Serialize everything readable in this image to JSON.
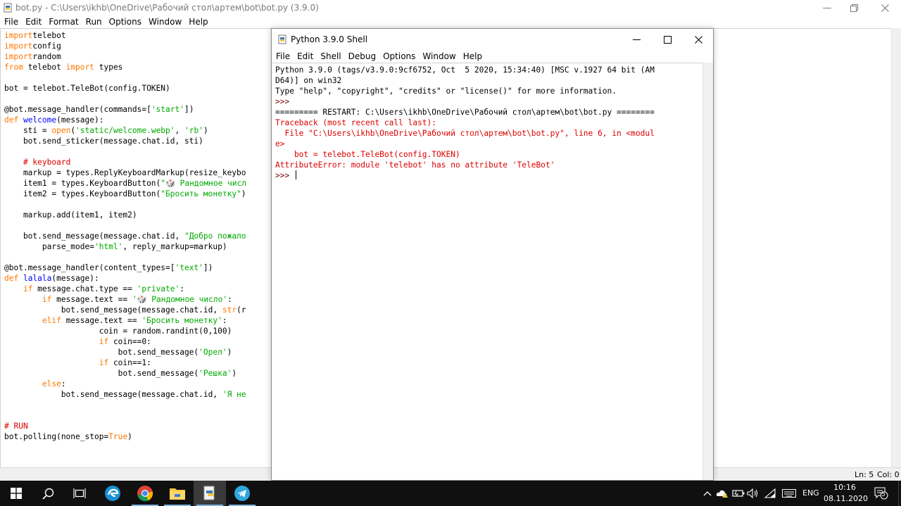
{
  "editor": {
    "title": "bot.py - C:\\Users\\ikhb\\OneDrive\\Рабочий стол\\артем\\bot\\bot.py (3.9.0)",
    "menu": [
      "File",
      "Edit",
      "Format",
      "Run",
      "Options",
      "Window",
      "Help"
    ],
    "code_lines": [
      [
        [
          "kw",
          "import"
        ],
        [
          "",
          "telebot"
        ]
      ],
      [
        [
          "kw",
          "import"
        ],
        [
          "",
          "config"
        ]
      ],
      [
        [
          "kw",
          "import"
        ],
        [
          "",
          "random"
        ]
      ],
      [
        [
          "kw",
          "from"
        ],
        [
          "",
          " telebot "
        ],
        [
          "kw",
          "import"
        ],
        [
          "",
          " types"
        ]
      ],
      [],
      [
        [
          "",
          "bot = telebot.TeleBot(config.TOKEN)"
        ]
      ],
      [],
      [
        [
          "",
          "@bot.message_handler(commands=["
        ],
        [
          "str",
          "'start'"
        ],
        [
          "",
          "])"
        ]
      ],
      [
        [
          "kw",
          "def"
        ],
        [
          "",
          " "
        ],
        [
          "def",
          "welcome"
        ],
        [
          "",
          "(message):"
        ]
      ],
      [
        [
          "",
          "    sti = "
        ],
        [
          "kw",
          "open"
        ],
        [
          "",
          "("
        ],
        [
          "str",
          "'static/welcome.webp'"
        ],
        [
          "",
          ", "
        ],
        [
          "str",
          "'rb'"
        ],
        [
          "",
          ")"
        ]
      ],
      [
        [
          "",
          "    bot.send_sticker(message.chat.id, sti)"
        ]
      ],
      [],
      [
        [
          "",
          "    "
        ],
        [
          "cm",
          "# keyboard"
        ]
      ],
      [
        [
          "",
          "    markup = types.ReplyKeyboardMarkup(resize_keybo"
        ]
      ],
      [
        [
          "",
          "    item1 = types.KeyboardButton("
        ],
        [
          "str",
          "\"🎲 Рандомное числ"
        ]
      ],
      [
        [
          "",
          "    item2 = types.KeyboardButton("
        ],
        [
          "str",
          "\"Бросить монетку\""
        ],
        [
          "",
          ")"
        ]
      ],
      [],
      [
        [
          "",
          "    markup.add(item1, item2)"
        ]
      ],
      [],
      [
        [
          "",
          "    bot.send_message(message.chat.id, "
        ],
        [
          "str",
          "\"Добро пожало"
        ]
      ],
      [
        [
          "",
          "        parse_mode="
        ],
        [
          "str",
          "'html'"
        ],
        [
          "",
          ", reply_markup=markup)"
        ]
      ],
      [],
      [
        [
          "",
          "@bot.message_handler(content_types=["
        ],
        [
          "str",
          "'text'"
        ],
        [
          "",
          "])"
        ]
      ],
      [
        [
          "kw",
          "def"
        ],
        [
          "",
          " "
        ],
        [
          "def",
          "lalala"
        ],
        [
          "",
          "(message):"
        ]
      ],
      [
        [
          "",
          "    "
        ],
        [
          "kw",
          "if"
        ],
        [
          "",
          " message.chat.type == "
        ],
        [
          "str",
          "'private'"
        ],
        [
          "",
          ":"
        ]
      ],
      [
        [
          "",
          "        "
        ],
        [
          "kw",
          "if"
        ],
        [
          "",
          " message.text == "
        ],
        [
          "str",
          "'🎲 Рандомное число'"
        ],
        [
          "",
          ":"
        ]
      ],
      [
        [
          "",
          "            bot.send_message(message.chat.id, "
        ],
        [
          "kw",
          "str"
        ],
        [
          "",
          "(r"
        ]
      ],
      [
        [
          "",
          "        "
        ],
        [
          "kw",
          "elif"
        ],
        [
          "",
          " message.text == "
        ],
        [
          "str",
          "'Бросить монетку'"
        ],
        [
          "",
          ":"
        ]
      ],
      [
        [
          "",
          "                    coin = random.randint(0,100)"
        ]
      ],
      [
        [
          "",
          "                    "
        ],
        [
          "kw",
          "if"
        ],
        [
          "",
          " coin==0:"
        ]
      ],
      [
        [
          "",
          "                        bot.send_message("
        ],
        [
          "str",
          "'Орел'"
        ],
        [
          "",
          ")"
        ]
      ],
      [
        [
          "",
          "                    "
        ],
        [
          "kw",
          "if"
        ],
        [
          "",
          " coin==1:"
        ]
      ],
      [
        [
          "",
          "                        bot.send_message("
        ],
        [
          "str",
          "'Решка'"
        ],
        [
          "",
          ")"
        ]
      ],
      [
        [
          "",
          "        "
        ],
        [
          "kw",
          "else"
        ],
        [
          "",
          ":"
        ]
      ],
      [
        [
          "",
          "            bot.send_message(message.chat.id, "
        ],
        [
          "str",
          "'Я не"
        ]
      ],
      [],
      [],
      [
        [
          "cm",
          "# RUN"
        ]
      ],
      [
        [
          "",
          "bot.polling(none_stop="
        ],
        [
          "kw",
          "True"
        ],
        [
          "",
          ")"
        ]
      ]
    ],
    "status": {
      "ln": "Ln: 5",
      "col": "Col: 0"
    }
  },
  "shell": {
    "title": "Python 3.9.0 Shell",
    "menu": [
      "File",
      "Edit",
      "Shell",
      "Debug",
      "Options",
      "Window",
      "Help"
    ],
    "lines": [
      [
        [
          "out",
          "Python 3.9.0 (tags/v3.9.0:9cf6752, Oct  5 2020, 15:34:40) [MSC v.1927 64 bit (AM"
        ]
      ],
      [
        [
          "out",
          "D64)] on win32"
        ]
      ],
      [
        [
          "out",
          "Type \"help\", \"copyright\", \"credits\" or \"license()\" for more information."
        ]
      ],
      [
        [
          "prompt",
          ">>> "
        ]
      ],
      [
        [
          "out",
          "========= RESTART: C:\\Users\\ikhb\\OneDrive\\Рабочий стол\\артем\\bot\\bot.py ========"
        ]
      ],
      [
        [
          "err",
          "Traceback (most recent call last):"
        ]
      ],
      [
        [
          "err",
          "  File \"C:\\Users\\ikhb\\OneDrive\\Рабочий стол\\артем\\bot\\bot.py\", line 6, in <modul"
        ]
      ],
      [
        [
          "err",
          "e>"
        ]
      ],
      [
        [
          "err",
          "    bot = telebot.TeleBot(config.TOKEN)"
        ]
      ],
      [
        [
          "err",
          "AttributeError: module 'telebot' has no attribute 'TeleBot'"
        ]
      ],
      [
        [
          "prompt",
          ">>> "
        ]
      ]
    ]
  },
  "taskbar": {
    "apps": [
      "start-icon",
      "search-icon",
      "task-view-icon",
      "edge-icon",
      "chrome-icon",
      "file-explorer-icon",
      "python-idle-icon",
      "telegram-icon"
    ],
    "language": "ENG",
    "time": "10:16",
    "date": "08.11.2020",
    "notification_count": "5"
  },
  "colors": {
    "keyword": "#ff7700",
    "string": "#00aa00",
    "definition": "#0000ff",
    "comment": "#dd0000",
    "error": "#dd0000",
    "taskbar": "#101010"
  }
}
